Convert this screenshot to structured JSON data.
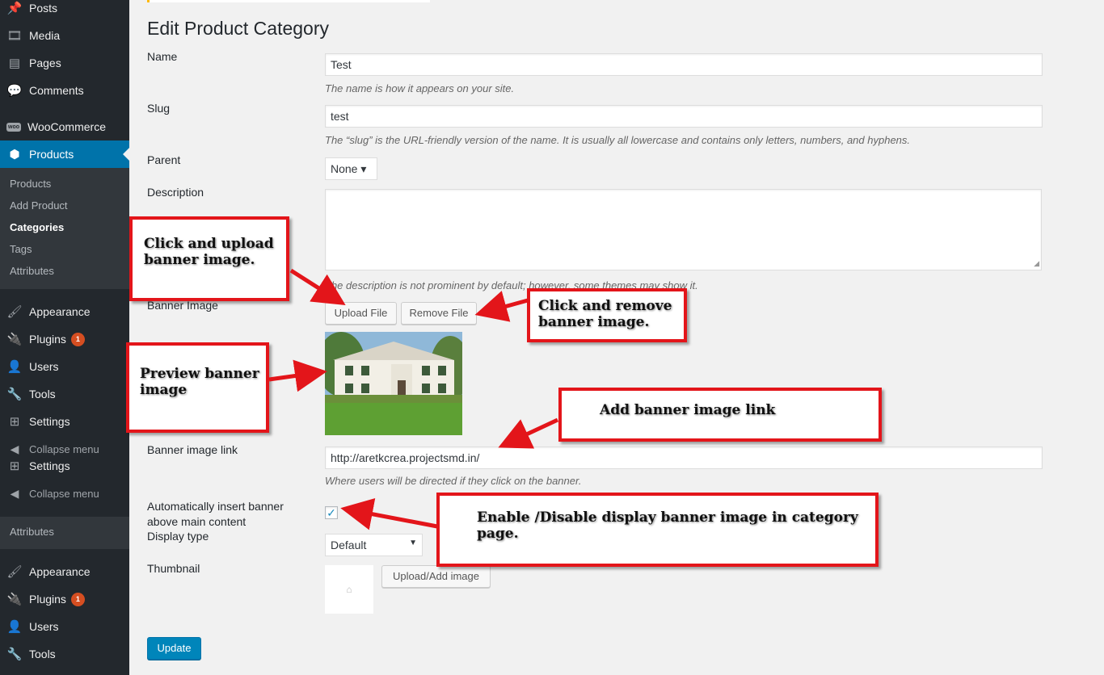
{
  "sidebar": {
    "posts": "Posts",
    "media": "Media",
    "pages": "Pages",
    "comments": "Comments",
    "woo_badge": "woo",
    "woocommerce": "WooCommerce",
    "products": "Products",
    "sub": {
      "products": "Products",
      "add_product": "Add Product",
      "categories": "Categories",
      "tags": "Tags",
      "attributes": "Attributes"
    },
    "appearance": "Appearance",
    "plugins": "Plugins",
    "plugins_count": "1",
    "users": "Users",
    "tools": "Tools",
    "settings": "Settings",
    "collapse": "Collapse menu",
    "attributes2": "Attributes",
    "appearance2": "Appearance",
    "plugins2": "Plugins",
    "plugins_count2": "1",
    "users2": "Users",
    "tools2": "Tools"
  },
  "main": {
    "title": "Edit Product Category",
    "name_label": "Name",
    "name_value": "Test",
    "name_desc": "The name is how it appears on your site.",
    "slug_label": "Slug",
    "slug_value": "test",
    "slug_desc": "The “slug” is the URL-friendly version of the name. It is usually all lowercase and contains only letters, numbers, and hyphens.",
    "parent_label": "Parent",
    "parent_value": "None ▾",
    "description_label": "Description",
    "description_desc": "The description is not prominent by default; however, some themes may show it.",
    "banner_label": "Banner Image",
    "upload_file": "Upload File",
    "remove_file": "Remove File",
    "banner_link_label": "Banner image link",
    "banner_link_value": "http://aretkcrea.projectsmd.in/",
    "banner_link_desc": "Where users will be directed if they click on the banner.",
    "auto_insert_label_1": "Automatically insert banner",
    "auto_insert_label_2": "above main content",
    "auto_insert_checked": "✓",
    "display_type_label": "Display type",
    "display_type_value": "Default",
    "thumbnail_label": "Thumbnail",
    "upload_add_image": "Upload/Add image",
    "update": "Update"
  },
  "notes": {
    "upload_1": "Click and upload",
    "upload_2": "banner image.",
    "remove_1": "Click and remove",
    "remove_2": "banner image.",
    "preview_1": "Preview banner",
    "preview_2": "image",
    "link": "Add banner image link",
    "enable": "Enable /Disable display banner image in category page."
  },
  "colors": {
    "accent": "#0073aa",
    "annotation": "#e3151a"
  }
}
